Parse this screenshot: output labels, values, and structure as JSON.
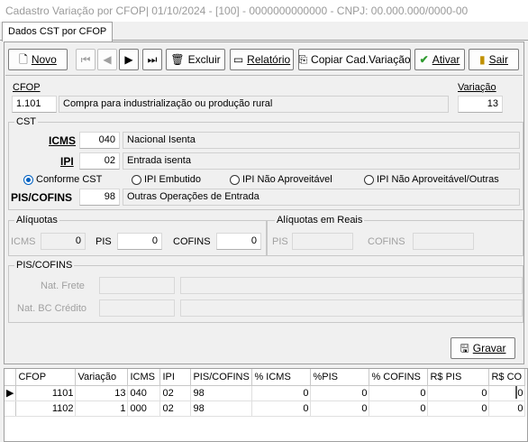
{
  "window": {
    "title": "Cadastro Variação por CFOP|  01/10/2024 - [100] - 0000000000000 - CNPJ: 00.000.000/0000-00"
  },
  "tab": {
    "label": "Dados CST por CFOP"
  },
  "toolbar": {
    "novo": "Novo",
    "excluir": "Excluir",
    "relatorio": "Relatório",
    "copiar": "Copiar Cad.Variação",
    "ativar": "Ativar",
    "sair": "Sair"
  },
  "cfop": {
    "label": "CFOP",
    "code": "1.101",
    "description": "Compra para industrialização ou produção rural",
    "variacao_label": "Variação",
    "variacao": "13"
  },
  "cst": {
    "group": "CST",
    "icms_label": "ICMS",
    "icms_code": "040",
    "icms_desc": "Nacional Isenta",
    "ipi_label": "IPI",
    "ipi_code": "02",
    "ipi_desc": "Entrada isenta",
    "radios": [
      "Conforme CST",
      "IPI Embutido",
      "IPI Não Aproveitável",
      "IPI Não Aproveitável/Outras"
    ],
    "selected_radio": "Conforme CST",
    "piscofins_label": "PIS/COFINS",
    "piscofins_code": "98",
    "piscofins_desc": "Outras Operações de Entrada"
  },
  "aliquotas": {
    "group": "Alíquotas",
    "icms_label": "ICMS",
    "icms": "0",
    "pis_label": "PIS",
    "pis": "0",
    "cofins_label": "COFINS",
    "cofins": "0"
  },
  "aliquotas_reais": {
    "group": "Alíquotas em Reais",
    "pis_label": "PIS",
    "cofins_label": "COFINS"
  },
  "piscofins_group": {
    "group": "PIS/COFINS",
    "nat_frete_label": "Nat. Frete",
    "nat_bc_label": "Nat. BC Crédito"
  },
  "gravar": "Gravar",
  "grid": {
    "columns": [
      "CFOP",
      "Variação",
      "ICMS",
      "IPI",
      "PIS/COFINS",
      "% ICMS",
      "%PIS",
      "% COFINS",
      "R$ PIS",
      "R$ CO"
    ],
    "rows": [
      [
        "1101",
        "13",
        "040",
        "02",
        "98",
        "0",
        "0",
        "0",
        "0",
        "0"
      ],
      [
        "1102",
        "1",
        "000",
        "02",
        "98",
        "0",
        "0",
        "0",
        "0",
        "0"
      ]
    ]
  },
  "colors": {
    "radio_accent": "#0060c0",
    "disabled_text": "#a0a0a0"
  }
}
